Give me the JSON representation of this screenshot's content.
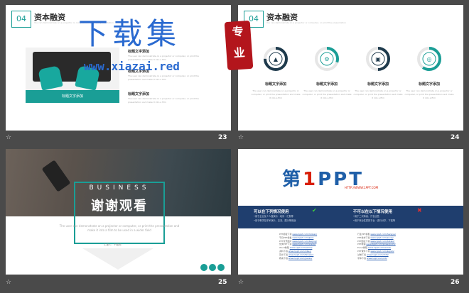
{
  "slides": [
    {
      "number": "23",
      "section": "04",
      "title": "资本融资",
      "subtitle": "You can demonstrate on a projector or computer, or print the presentation",
      "image_caption": "标题文字添加",
      "items": [
        {
          "label": "标题文字添加",
          "text": "The user can demonstrate on a projector or computer, or print the presentation and make it into a film"
        },
        {
          "label": "标题文字添加",
          "text": "The user can demonstrate on a projector or computer, or print the presentation and make it into a film"
        },
        {
          "label": "标题文字添加",
          "text": "The user can demonstrate on a projector or computer, or print the presentation and make it into a film"
        }
      ]
    },
    {
      "number": "24",
      "section": "04",
      "title": "资本融资",
      "subtitle": "You can demonstrate on a projector or computer, or print the presentation",
      "rings": [
        {
          "label": "标题文字添加",
          "text": "The user can demonstrate on a projector or computer, or print the presentation and make it into a film",
          "icon": "rocket-icon",
          "color": "#1e3a4c",
          "progress": 0.75
        },
        {
          "label": "标题文字添加",
          "text": "The user can demonstrate on a projector or computer, or print the presentation and make it into a film",
          "icon": "gear-icon",
          "color": "#1a9e96",
          "progress": 0.3
        },
        {
          "label": "标题文字添加",
          "text": "The user can demonstrate on a projector or computer, or print the presentation and make it into a film",
          "icon": "train-icon",
          "color": "#1e3a4c",
          "progress": 0.5
        },
        {
          "label": "标题文字添加",
          "text": "The user can demonstrate on a projector or computer, or print the presentation and make it into a film",
          "icon": "target-icon",
          "color": "#1a9e96",
          "progress": 0.6
        }
      ]
    },
    {
      "number": "25",
      "business": "BUSINESS",
      "thanks": "谢谢观看",
      "description": "The user can demonstrate on a projector or computer, or print the presentation and make it into a film to be used in a wider field",
      "reporter": "汇报人：千图网"
    },
    {
      "number": "26",
      "logo_prefix": "第",
      "logo_one": "1",
      "logo_suffix": "PPT",
      "logo_url": "HTTP://WWW.1PPT.COM",
      "allowed_title": "可以在下列情况使用",
      "allowed_items": [
        "•用于企业及个人做演示 · 培训 · 汇报等",
        "•用于教学及学术演示、交流、展示等用途"
      ],
      "forbidden_title": "不可以在以下情况使用",
      "forbidden_items": [
        "•用于二次转卖、打包出售",
        "•用于商业性质的平台 · 进行分享、下载等"
      ],
      "links_left": [
        {
          "k": "PPT模板下载",
          "v": "www.1ppt.com/moban/"
        },
        {
          "k": "节日PPT模板",
          "v": "www.1ppt.com/jieri/"
        },
        {
          "k": "PPT背景图片",
          "v": "www.1ppt.com/beijing/"
        },
        {
          "k": "优秀PPT下载",
          "v": "www.1ppt.com/xiazai/"
        },
        {
          "k": "Word教程",
          "v": "www.1ppt.com/word/"
        },
        {
          "k": "资料下载",
          "v": "www.1ppt.com/ziliao/"
        },
        {
          "k": "范文下载",
          "v": "www.1ppt.com/fanwen/"
        },
        {
          "k": "教案下载",
          "v": "www.1ppt.com/jiaoan/"
        }
      ],
      "links_right": [
        {
          "k": "行业PPT模板",
          "v": "www.1ppt.com/hangye/"
        },
        {
          "k": "PPT素材下载",
          "v": "www.1ppt.com/sucai/"
        },
        {
          "k": "PPT图表下载",
          "v": "www.1ppt.com/tubiao/"
        },
        {
          "k": "PPT教程",
          "v": "www.1ppt.com/powerpoint/"
        },
        {
          "k": "Excel教程",
          "v": "www.1ppt.com/excel/"
        },
        {
          "k": "PPT课件下载",
          "v": "www.1ppt.com/kejian/"
        },
        {
          "k": "试卷下载",
          "v": "www.1ppt.com/shiti/"
        },
        {
          "k": "字体下载",
          "v": "www.1ppt.com/ziti/"
        }
      ]
    }
  ],
  "star_glyph": "☆",
  "watermark": {
    "big": "下载集",
    "site": "www.xiazai.red",
    "seal_top": "专",
    "seal_bottom": "业"
  }
}
